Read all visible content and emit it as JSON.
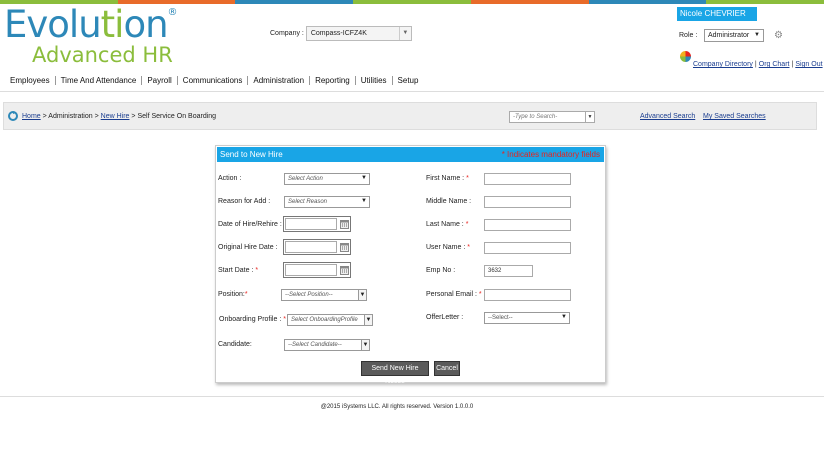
{
  "colors": {
    "accent": "#19a5e6",
    "brand_blue": "#2d88b8",
    "brand_green": "#8bbd3c",
    "required": "#e8231e",
    "stripe": [
      "#8bbd3c",
      "#e86b2a",
      "#2d88b8",
      "#8bbd3c",
      "#e86b2a",
      "#2d88b8",
      "#8bbd3c"
    ]
  },
  "logo": {
    "line1_a": "Evolu",
    "line1_b": "ti",
    "line1_c": "on",
    "reg": "®",
    "line2": "Advanced HR"
  },
  "company": {
    "label": "Company :",
    "value": "Compass-ICFZ4K"
  },
  "user": {
    "name": "Nicole CHEVRIER",
    "role_label": "Role :",
    "role_value": "Administrator",
    "links": {
      "directory": "Company Directory",
      "org_chart": "Org Chart",
      "sign_out": "Sign Out",
      "sep": "|"
    }
  },
  "nav": [
    "Employees",
    "Time And Attendance",
    "Payroll",
    "Communications",
    "Administration",
    "Reporting",
    "Utilities",
    "Setup"
  ],
  "breadcrumb": {
    "home": "Home",
    "sep": ">",
    "admin": "Administration",
    "new_hire": "New Hire",
    "current": "Self Service On Boarding"
  },
  "search": {
    "placeholder": "-Type to Search-",
    "advanced": "Advanced Search",
    "saved": "My Saved Searches"
  },
  "form": {
    "title": "Send to New Hire",
    "mandatory_note": "* Indicates mandatory fields",
    "action_label": "Action :",
    "action_value": "Select Action",
    "reason_label": "Reason for Add :",
    "reason_value": "Select Reason",
    "hire_label": "Date of Hire/Rehire :",
    "orig_label": "Original Hire Date :",
    "start_label": "Start Date :",
    "position_label": "Position:",
    "position_value": "--Select Position--",
    "onboard_label": "Onboarding Profile :",
    "onboard_value": "Select OnboardingProfile",
    "candidate_label": "Candidate:",
    "candidate_value": "--Select Candidate--",
    "first_label": "First Name :",
    "middle_label": "Middle Name :",
    "last_label": "Last Name :",
    "user_label": "User Name :",
    "emp_label": "Emp No :",
    "emp_value": "3632",
    "email_label": "Personal Email :",
    "offer_label": "OfferLetter :",
    "offer_value": "--Select--",
    "required_mark": "*",
    "send_button": "Send New Hire Notice",
    "cancel_button": "Cancel"
  },
  "footer": "@2015 iSystems LLC. All rights reserved. Version 1.0.0.0"
}
